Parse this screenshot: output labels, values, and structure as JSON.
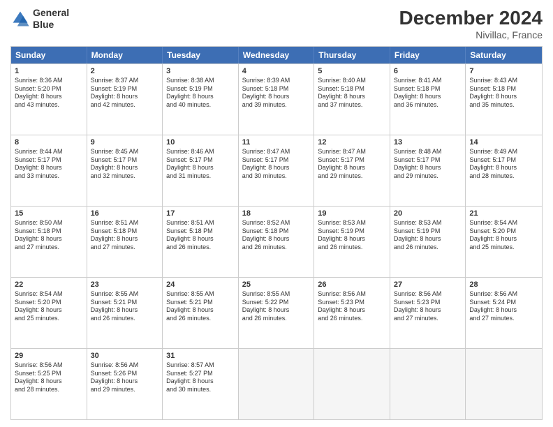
{
  "header": {
    "logo_line1": "General",
    "logo_line2": "Blue",
    "month": "December 2024",
    "location": "Nivillac, France"
  },
  "weekdays": [
    "Sunday",
    "Monday",
    "Tuesday",
    "Wednesday",
    "Thursday",
    "Friday",
    "Saturday"
  ],
  "rows": [
    [
      {
        "day": "1",
        "lines": [
          "Sunrise: 8:36 AM",
          "Sunset: 5:20 PM",
          "Daylight: 8 hours",
          "and 43 minutes."
        ]
      },
      {
        "day": "2",
        "lines": [
          "Sunrise: 8:37 AM",
          "Sunset: 5:19 PM",
          "Daylight: 8 hours",
          "and 42 minutes."
        ]
      },
      {
        "day": "3",
        "lines": [
          "Sunrise: 8:38 AM",
          "Sunset: 5:19 PM",
          "Daylight: 8 hours",
          "and 40 minutes."
        ]
      },
      {
        "day": "4",
        "lines": [
          "Sunrise: 8:39 AM",
          "Sunset: 5:18 PM",
          "Daylight: 8 hours",
          "and 39 minutes."
        ]
      },
      {
        "day": "5",
        "lines": [
          "Sunrise: 8:40 AM",
          "Sunset: 5:18 PM",
          "Daylight: 8 hours",
          "and 37 minutes."
        ]
      },
      {
        "day": "6",
        "lines": [
          "Sunrise: 8:41 AM",
          "Sunset: 5:18 PM",
          "Daylight: 8 hours",
          "and 36 minutes."
        ]
      },
      {
        "day": "7",
        "lines": [
          "Sunrise: 8:43 AM",
          "Sunset: 5:18 PM",
          "Daylight: 8 hours",
          "and 35 minutes."
        ]
      }
    ],
    [
      {
        "day": "8",
        "lines": [
          "Sunrise: 8:44 AM",
          "Sunset: 5:17 PM",
          "Daylight: 8 hours",
          "and 33 minutes."
        ]
      },
      {
        "day": "9",
        "lines": [
          "Sunrise: 8:45 AM",
          "Sunset: 5:17 PM",
          "Daylight: 8 hours",
          "and 32 minutes."
        ]
      },
      {
        "day": "10",
        "lines": [
          "Sunrise: 8:46 AM",
          "Sunset: 5:17 PM",
          "Daylight: 8 hours",
          "and 31 minutes."
        ]
      },
      {
        "day": "11",
        "lines": [
          "Sunrise: 8:47 AM",
          "Sunset: 5:17 PM",
          "Daylight: 8 hours",
          "and 30 minutes."
        ]
      },
      {
        "day": "12",
        "lines": [
          "Sunrise: 8:47 AM",
          "Sunset: 5:17 PM",
          "Daylight: 8 hours",
          "and 29 minutes."
        ]
      },
      {
        "day": "13",
        "lines": [
          "Sunrise: 8:48 AM",
          "Sunset: 5:17 PM",
          "Daylight: 8 hours",
          "and 29 minutes."
        ]
      },
      {
        "day": "14",
        "lines": [
          "Sunrise: 8:49 AM",
          "Sunset: 5:17 PM",
          "Daylight: 8 hours",
          "and 28 minutes."
        ]
      }
    ],
    [
      {
        "day": "15",
        "lines": [
          "Sunrise: 8:50 AM",
          "Sunset: 5:18 PM",
          "Daylight: 8 hours",
          "and 27 minutes."
        ]
      },
      {
        "day": "16",
        "lines": [
          "Sunrise: 8:51 AM",
          "Sunset: 5:18 PM",
          "Daylight: 8 hours",
          "and 27 minutes."
        ]
      },
      {
        "day": "17",
        "lines": [
          "Sunrise: 8:51 AM",
          "Sunset: 5:18 PM",
          "Daylight: 8 hours",
          "and 26 minutes."
        ]
      },
      {
        "day": "18",
        "lines": [
          "Sunrise: 8:52 AM",
          "Sunset: 5:18 PM",
          "Daylight: 8 hours",
          "and 26 minutes."
        ]
      },
      {
        "day": "19",
        "lines": [
          "Sunrise: 8:53 AM",
          "Sunset: 5:19 PM",
          "Daylight: 8 hours",
          "and 26 minutes."
        ]
      },
      {
        "day": "20",
        "lines": [
          "Sunrise: 8:53 AM",
          "Sunset: 5:19 PM",
          "Daylight: 8 hours",
          "and 26 minutes."
        ]
      },
      {
        "day": "21",
        "lines": [
          "Sunrise: 8:54 AM",
          "Sunset: 5:20 PM",
          "Daylight: 8 hours",
          "and 25 minutes."
        ]
      }
    ],
    [
      {
        "day": "22",
        "lines": [
          "Sunrise: 8:54 AM",
          "Sunset: 5:20 PM",
          "Daylight: 8 hours",
          "and 25 minutes."
        ]
      },
      {
        "day": "23",
        "lines": [
          "Sunrise: 8:55 AM",
          "Sunset: 5:21 PM",
          "Daylight: 8 hours",
          "and 26 minutes."
        ]
      },
      {
        "day": "24",
        "lines": [
          "Sunrise: 8:55 AM",
          "Sunset: 5:21 PM",
          "Daylight: 8 hours",
          "and 26 minutes."
        ]
      },
      {
        "day": "25",
        "lines": [
          "Sunrise: 8:55 AM",
          "Sunset: 5:22 PM",
          "Daylight: 8 hours",
          "and 26 minutes."
        ]
      },
      {
        "day": "26",
        "lines": [
          "Sunrise: 8:56 AM",
          "Sunset: 5:23 PM",
          "Daylight: 8 hours",
          "and 26 minutes."
        ]
      },
      {
        "day": "27",
        "lines": [
          "Sunrise: 8:56 AM",
          "Sunset: 5:23 PM",
          "Daylight: 8 hours",
          "and 27 minutes."
        ]
      },
      {
        "day": "28",
        "lines": [
          "Sunrise: 8:56 AM",
          "Sunset: 5:24 PM",
          "Daylight: 8 hours",
          "and 27 minutes."
        ]
      }
    ],
    [
      {
        "day": "29",
        "lines": [
          "Sunrise: 8:56 AM",
          "Sunset: 5:25 PM",
          "Daylight: 8 hours",
          "and 28 minutes."
        ]
      },
      {
        "day": "30",
        "lines": [
          "Sunrise: 8:56 AM",
          "Sunset: 5:26 PM",
          "Daylight: 8 hours",
          "and 29 minutes."
        ]
      },
      {
        "day": "31",
        "lines": [
          "Sunrise: 8:57 AM",
          "Sunset: 5:27 PM",
          "Daylight: 8 hours",
          "and 30 minutes."
        ]
      },
      {
        "day": "",
        "lines": []
      },
      {
        "day": "",
        "lines": []
      },
      {
        "day": "",
        "lines": []
      },
      {
        "day": "",
        "lines": []
      }
    ]
  ]
}
